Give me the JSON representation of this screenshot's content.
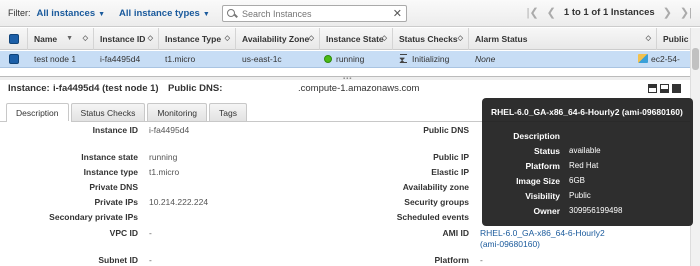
{
  "filter": {
    "label": "Filter:",
    "instances_dropdown": "All instances",
    "types_dropdown": "All instance types",
    "search_placeholder": "Search Instances",
    "pagination": "1 to 1 of 1 Instances"
  },
  "table": {
    "columns": [
      "Name",
      "Instance ID",
      "Instance Type",
      "Availability Zone",
      "Instance State",
      "Status Checks",
      "Alarm Status",
      "Public"
    ],
    "row": {
      "name": "test node 1",
      "instance_id": "i-fa4495d4",
      "instance_type": "t1.micro",
      "availability_zone": "us-east-1c",
      "instance_state": "running",
      "status_checks": "Initializing",
      "alarm_status": "None",
      "public": "ec2-54-"
    }
  },
  "details": {
    "instance_label": "Instance:",
    "instance_value": "i-fa4495d4 (test node 1)",
    "dns_label": "Public DNS:",
    "dns_value": ".compute-1.amazonaws.com",
    "tabs": [
      "Description",
      "Status Checks",
      "Monitoring",
      "Tags"
    ],
    "left": [
      {
        "label": "Instance ID",
        "value": "i-fa4495d4"
      },
      {
        "label": "Instance state",
        "value": "running"
      },
      {
        "label": "Instance type",
        "value": "t1.micro"
      },
      {
        "label": "Private DNS",
        "value": ""
      },
      {
        "label": "Private IPs",
        "value": "10.214.222.224"
      },
      {
        "label": "Secondary private IPs",
        "value": ""
      },
      {
        "label": "VPC ID",
        "value": "-"
      },
      {
        "label": "Subnet ID",
        "value": "-"
      }
    ],
    "right": [
      {
        "label": "Public DNS",
        "value": ""
      },
      {
        "label": "Public IP",
        "value": ""
      },
      {
        "label": "Elastic IP",
        "value": ""
      },
      {
        "label": "Availability zone",
        "value": ""
      },
      {
        "label": "Security groups",
        "value": ""
      },
      {
        "label": "Scheduled events",
        "value": ""
      },
      {
        "label": "AMI ID",
        "value": "RHEL-6.0_GA-x86_64-6-Hourly2 (ami-09680160)"
      },
      {
        "label": "Platform",
        "value": "-"
      }
    ]
  },
  "tooltip": {
    "title": "RHEL-6.0_GA-x86_64-6-Hourly2 (ami-09680160)",
    "rows": [
      {
        "label": "Description",
        "value": ""
      },
      {
        "label": "Status",
        "value": "available"
      },
      {
        "label": "Platform",
        "value": "Red Hat"
      },
      {
        "label": "Image Size",
        "value": "6GB"
      },
      {
        "label": "Visibility",
        "value": "Public"
      },
      {
        "label": "Owner",
        "value": "309956199498"
      }
    ]
  },
  "colors": {
    "accent": "#1a5a9c",
    "selected_row": "#c7ddf5",
    "running": "#4cbb17",
    "tooltip_bg": "#1e1e1e"
  }
}
